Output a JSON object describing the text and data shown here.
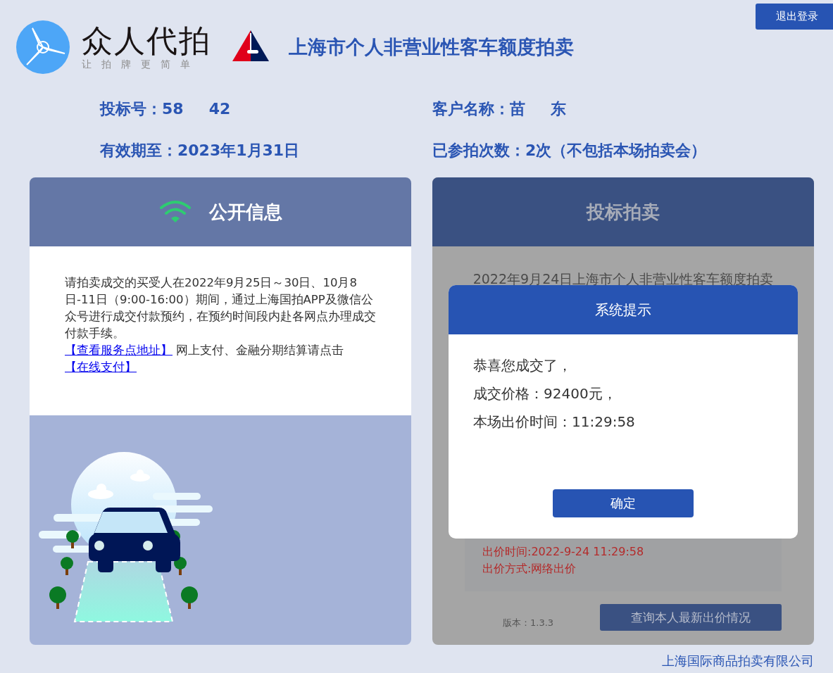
{
  "header": {
    "brand": "众人代拍",
    "slogan": "让拍牌更简单",
    "title": "上海市个人非营业性客车额度拍卖",
    "logout_button": "退出登录"
  },
  "info": [
    {
      "label": "投标号：",
      "value_parts": [
        "58",
        "42"
      ]
    },
    {
      "label": "客户名称：",
      "value_parts": [
        "苗",
        "东"
      ]
    },
    {
      "label": "有效期至：",
      "value_parts": [
        "2023年1月31日"
      ]
    },
    {
      "label": "已参拍次数：",
      "value_parts": [
        "2次（不包括本场拍卖会）"
      ]
    }
  ],
  "public_info": {
    "title": "公开信息",
    "paragraphs": [
      [
        {
          "kind": "text",
          "text": "请拍卖成交的买受人在2022年9月25日～30日、10月8日-11日（9:00-16:00）期间，通过上海国拍APP及微信公众号进行成交付款预约，在预约时间段内赴各网点办理成交付款手续。"
        }
      ],
      [
        {
          "kind": "link",
          "text": "【查看服务点地址】"
        },
        {
          "kind": "text",
          "text": " 网上支付、金融分期结算请点击"
        },
        {
          "kind": "link",
          "text": "【在线支付】"
        }
      ]
    ]
  },
  "bidding": {
    "title": "投标拍卖",
    "auction_title": "2022年9月24日上海市个人非营业性客车额度拍卖",
    "bid_details": [
      "出价时间:2022-9-24 11:29:58",
      "出价方式:网络出价"
    ],
    "version": "版本：1.3.3",
    "query_button": "查询本人最新出价情况"
  },
  "dialog": {
    "title": "系统提示",
    "lines": [
      "恭喜您成交了，",
      "成交价格：92400元，",
      "本场出价时间：11:29:58"
    ],
    "confirm_button": "确定"
  },
  "footer": "上海国际商品拍卖有限公司"
}
